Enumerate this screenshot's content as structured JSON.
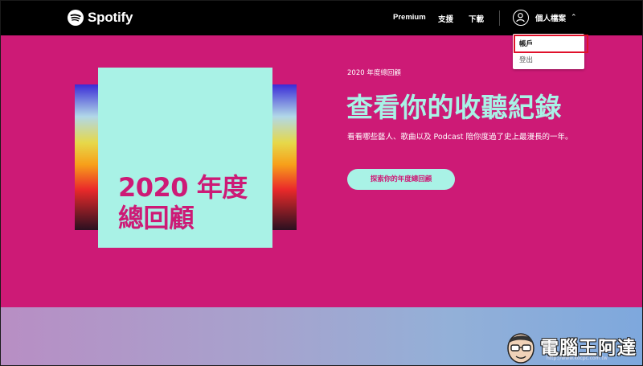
{
  "header": {
    "logo_text": "Spotify",
    "nav": {
      "premium": "Premium",
      "support": "支援",
      "download": "下載"
    },
    "profile": {
      "label": "個人檔案",
      "avatar_icon": "user-icon",
      "chevron_icon": "chevron-up-icon"
    }
  },
  "dropdown": {
    "account": "帳戶",
    "logout": "登出"
  },
  "hero": {
    "art_title_line1": "2020 年度",
    "art_title_line2": "總回顧",
    "eyebrow": "2020 年度總回顧",
    "headline": "查看你的收聽紀錄",
    "description": "看看哪些藝人、歌曲以及 Podcast 陪你度過了史上最漫長的一年。",
    "cta": "探索你的年度總回顧"
  },
  "watermark": {
    "text": "電腦王阿達",
    "url": "http://www.kocpc.com.tw"
  },
  "colors": {
    "background": "#cd1a76",
    "accent": "#a9f2e6",
    "header": "#000000",
    "highlight_border": "#e0112b"
  }
}
